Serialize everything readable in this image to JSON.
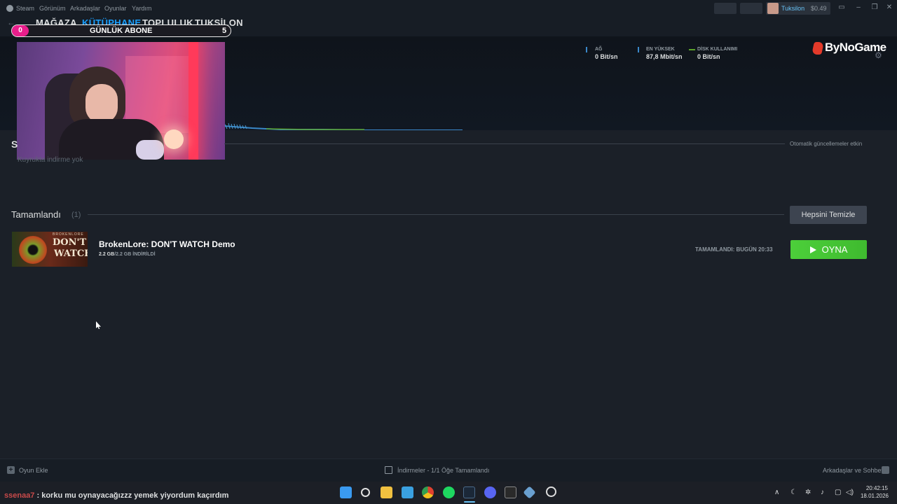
{
  "menu": {
    "items": [
      "Steam",
      "Görünüm",
      "Arkadaşlar",
      "Oyunlar",
      "Yardım"
    ]
  },
  "user": {
    "name": "Tuksilon",
    "wallet": "$0.49"
  },
  "nav": {
    "tabs": [
      "MAĞAZA",
      "KÜTÜPHANE",
      "TOPLULUK",
      "TUKSİLON"
    ],
    "active": "KÜTÜPHANE"
  },
  "overlay": {
    "badge": "0",
    "label": "GÜNLÜK ABONE",
    "count": "5"
  },
  "stats": {
    "network_label": "AĞ",
    "network_value": "0 Bit/sn",
    "peak_label": "EN YÜKSEK",
    "peak_value": "87,8 Mbit/sn",
    "disk_label": "DİSK KULLANIMI",
    "disk_value": "0 Bit/sn"
  },
  "logo": "ByNoGame",
  "queue": {
    "heading_visible": "S",
    "auto_updates": "Otomatik güncellemeler etkin",
    "empty_text": "Kuyrukta indirme yok"
  },
  "completed": {
    "title": "Tamamlandı",
    "count": "(1)",
    "clear_button": "Hepsini Temizle",
    "items": [
      {
        "thumb_top": "BROKENLORE",
        "thumb_line1": "DON'T",
        "thumb_line2": "WATCH",
        "title": "BrokenLore: DON'T WATCH Demo",
        "size_done": "2.2 GB",
        "size_rest": "/2.2 GB İNDİRİLDİ",
        "completed_at": "TAMAMLANDI: BUGÜN 20:33",
        "play_label": "OYNA"
      }
    ]
  },
  "bottom": {
    "add_game": "Oyun Ekle",
    "download_status": "İndirmeler - 1/1 Öğe Tamamlandı",
    "friends_chat": "Arkadaşlar ve Sohbet"
  },
  "chat": {
    "user": "ssenaa7",
    "message": ": korku mu oynayacağızzz yemek yiyordum kaçırdım"
  },
  "clock": {
    "time": "20:42:15",
    "date": "18.01.2026"
  },
  "colors": {
    "accent": "#1a9fff",
    "play_green": "#4ccf3a",
    "background": "#1b2028",
    "badge_pink": "#e91e8c"
  }
}
